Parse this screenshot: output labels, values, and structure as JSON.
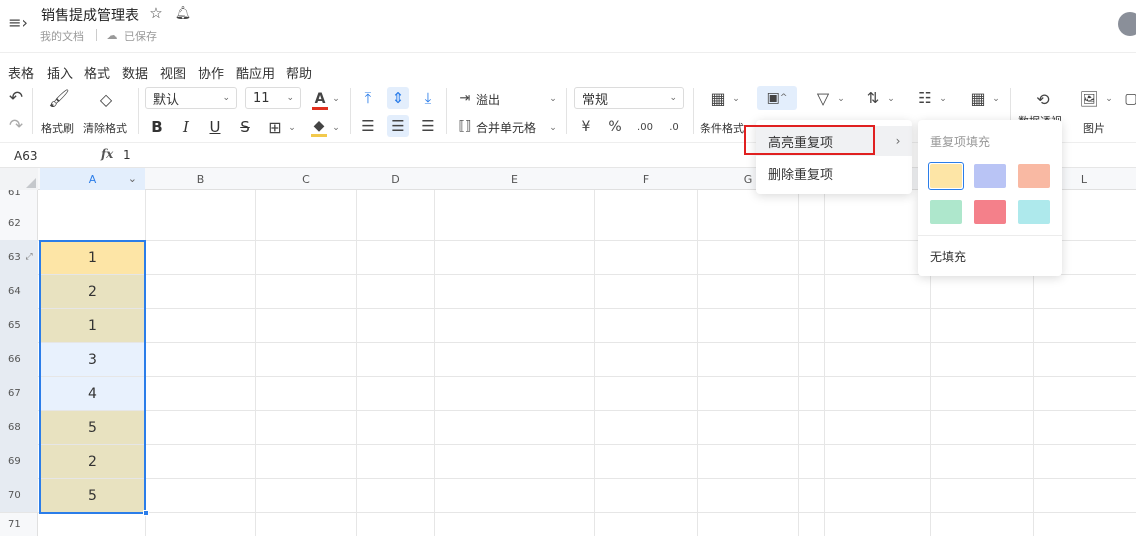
{
  "title_bar": {
    "doc_title": "销售提成管理表",
    "location": "我的文档",
    "save_status": "已保存"
  },
  "menu_bar": [
    "表格",
    "插入",
    "格式",
    "数据",
    "视图",
    "协作",
    "酷应用",
    "帮助"
  ],
  "toolbar": {
    "format_painter": "格式刷",
    "clear_format": "清除格式",
    "font_name": "默认",
    "font_size": "11",
    "font_color_glyph": "A",
    "bold": "B",
    "italic": "I",
    "underline": "U",
    "strike": "S",
    "overflow": "溢出",
    "merge_cells": "合并单元格",
    "number_format": "常规",
    "currency": "¥",
    "percent": "%",
    "cond_format": "条件格式",
    "pivot": "数据透视",
    "picture": "图片",
    "font_color": "#e0301e",
    "fill_color": "#f2c94c"
  },
  "formula_bar": {
    "cell_ref": "A63",
    "fx": "fx",
    "value": "1"
  },
  "columns": [
    "A",
    "B",
    "C",
    "D",
    "E",
    "F",
    "G",
    "L"
  ],
  "rows": [
    {
      "num": "61",
      "value": ""
    },
    {
      "num": "62",
      "value": ""
    },
    {
      "num": "63",
      "value": "1"
    },
    {
      "num": "64",
      "value": "2"
    },
    {
      "num": "65",
      "value": "1"
    },
    {
      "num": "66",
      "value": "3"
    },
    {
      "num": "67",
      "value": "4"
    },
    {
      "num": "68",
      "value": "5"
    },
    {
      "num": "69",
      "value": "2"
    },
    {
      "num": "70",
      "value": "5"
    },
    {
      "num": "71",
      "value": ""
    }
  ],
  "dropdown_menu": {
    "highlight_duplicates": "高亮重复项",
    "remove_duplicates": "删除重复项"
  },
  "submenu": {
    "header": "重复项填充",
    "swatches": [
      "#fde5a6",
      "#b9c4f5",
      "#f9b9a3",
      "#aee7cc",
      "#f4808a",
      "#aee9ec"
    ],
    "no_fill": "无填充"
  },
  "colors": {
    "cell_highlight": "#fde5a6",
    "cell_duplicate": "#e8e2c0",
    "cell_selected": "#e8f1fd",
    "selection_border": "#2b7de9",
    "red_box": "#e02020"
  }
}
